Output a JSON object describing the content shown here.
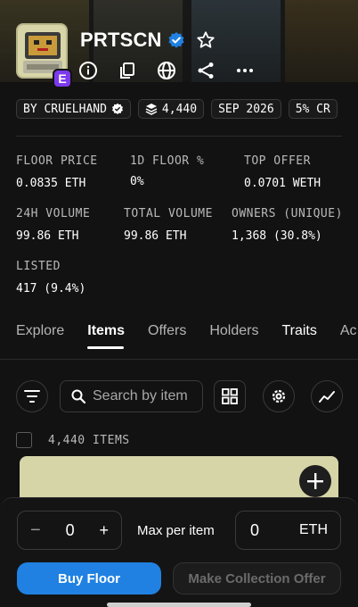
{
  "collection": {
    "name": "PRTSCN",
    "avatar_text": "PRTSCN",
    "badge_letter": "E"
  },
  "chips": {
    "creator": "BY CRUELHAND",
    "items": "4,440",
    "date": "SEP 2026",
    "fee": "5% CR"
  },
  "stats": {
    "floor_price": {
      "label": "FLOOR PRICE",
      "value": "0.0835 ETH"
    },
    "floor_1d": {
      "label": "1D FLOOR %",
      "value": "0%"
    },
    "top_offer": {
      "label": "TOP OFFER",
      "value": "0.0701 WETH"
    },
    "volume_24h": {
      "label": "24H VOLUME",
      "value": "99.86 ETH"
    },
    "total_volume": {
      "label": "TOTAL VOLUME",
      "value": "99.86 ETH"
    },
    "owners": {
      "label": "OWNERS (UNIQUE)",
      "value": "1,368 (30.8%)"
    },
    "listed": {
      "label": "LISTED",
      "value": "417 (9.4%)"
    }
  },
  "tabs": [
    {
      "label": "Explore",
      "active": false
    },
    {
      "label": "Items",
      "active": true
    },
    {
      "label": "Offers",
      "active": false
    },
    {
      "label": "Holders",
      "active": false
    },
    {
      "label": "Traits",
      "active": false
    },
    {
      "label": "Ac",
      "active": false
    }
  ],
  "search": {
    "placeholder": "Search by item"
  },
  "items_count": "4,440 ITEMS",
  "bottom": {
    "quantity": "0",
    "minus": "−",
    "plus": "+",
    "max_label": "Max per item",
    "price_value": "0",
    "price_unit": "ETH",
    "buy_label": "Buy Floor",
    "offer_label": "Make Collection Offer"
  },
  "colors": {
    "background": "#121212",
    "accent_blue": "#2081e2",
    "verified_blue": "#2081e2",
    "badge_purple": "#7c3aed",
    "card": "#d6d5a8"
  },
  "icons": [
    "info-icon",
    "copy-icon",
    "globe-icon",
    "share-icon",
    "more-icon",
    "star-icon",
    "verified-icon",
    "layers-icon",
    "filter-icon",
    "search-icon",
    "grid-icon",
    "settings-icon",
    "chart-icon",
    "plus-icon"
  ]
}
